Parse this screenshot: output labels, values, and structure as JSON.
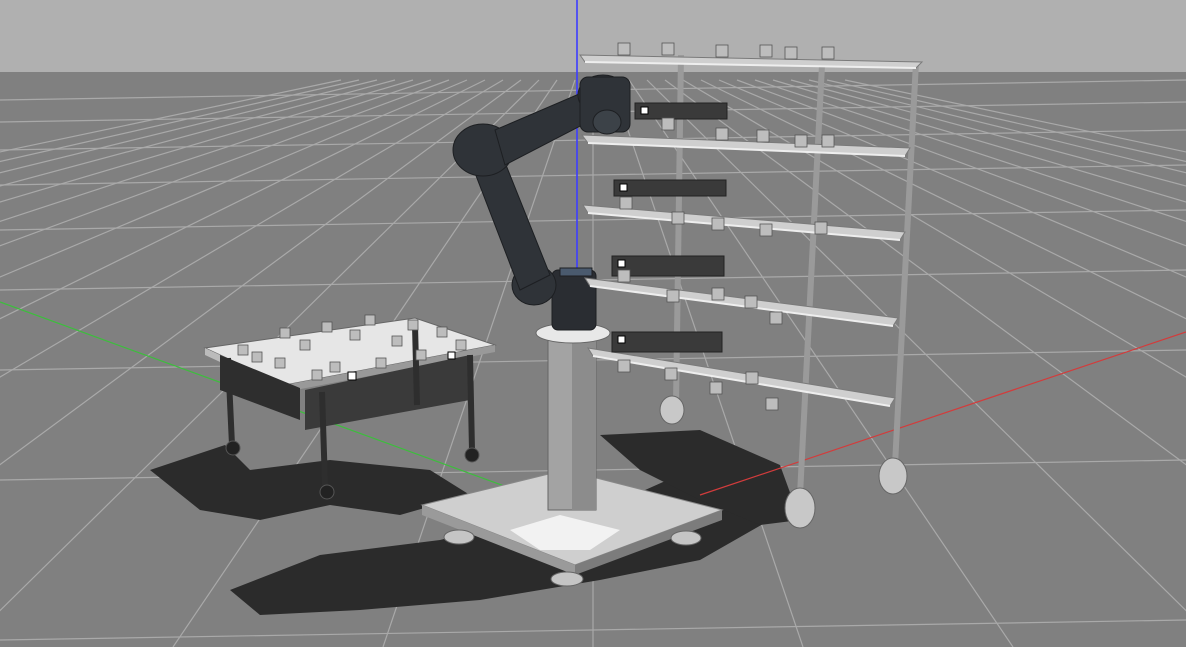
{
  "window": {
    "kind": "3d-simulation-viewport",
    "background_color": "#b0b0b0",
    "ground_color": "#7f7f7f",
    "grid_color": "#a6a6a6"
  },
  "scene": {
    "axes": {
      "x_axis_color": "#d23c3c",
      "y_axis_color": "#3cbe3c",
      "z_axis_color": "#3c3cff"
    },
    "objects": [
      {
        "name": "robot-arm",
        "description_icon": "robot-arm-icon",
        "color": "#2f3338"
      },
      {
        "name": "robot-pedestal",
        "description_icon": "pedestal-icon",
        "color": "#9a9a9a"
      },
      {
        "name": "work-table",
        "description_icon": "table-icon",
        "color": "#3a3a3a"
      },
      {
        "name": "storage-shelf",
        "description_icon": "shelf-icon",
        "color": "#9a9a9a"
      }
    ]
  }
}
